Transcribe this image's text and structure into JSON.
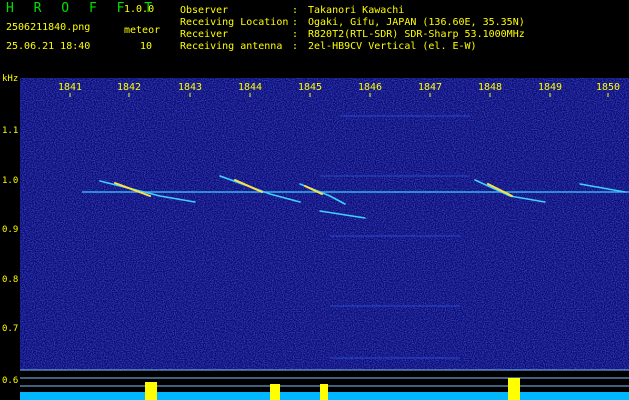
{
  "header": {
    "app_title": "H R O F F T",
    "app_version": "1.0.0",
    "file_name": "2506211840.png",
    "meteor_label": "meteor",
    "date_time": "25.06.21 18:40",
    "meteor_count": "10",
    "info_rows": [
      {
        "key": "Observer",
        "sep": ":",
        "value": "Takanori Kawachi"
      },
      {
        "key": "Receiving Location",
        "sep": ":",
        "value": "Ogaki, Gifu, JAPAN (136.60E, 35.35N)"
      },
      {
        "key": "Receiver",
        "sep": ":",
        "value": "R820T2(RTL-SDR) SDR-Sharp 53.1000MHz"
      },
      {
        "key": "Receiving antenna",
        "sep": ":",
        "value": "2el-HB9CV Vertical (el. E-W)"
      }
    ]
  },
  "axis": {
    "unit_label": "kHz",
    "x_ticks": [
      "1841",
      "1842",
      "1843",
      "1844",
      "1845",
      "1846",
      "1847",
      "1848",
      "1849",
      "1850"
    ],
    "y_ticks": [
      "1.1",
      "1.0",
      "0.9",
      "0.8",
      "0.7",
      "0.6"
    ]
  },
  "colors": {
    "background": "#000000",
    "spectrogram_base": "#0a0a6e",
    "label": "#ffff00",
    "title": "#00e000",
    "carrier": "#40c8ff",
    "meteor": "#ffe040",
    "baseline": "#00c8ff",
    "count_bar": "#ffff00"
  }
}
